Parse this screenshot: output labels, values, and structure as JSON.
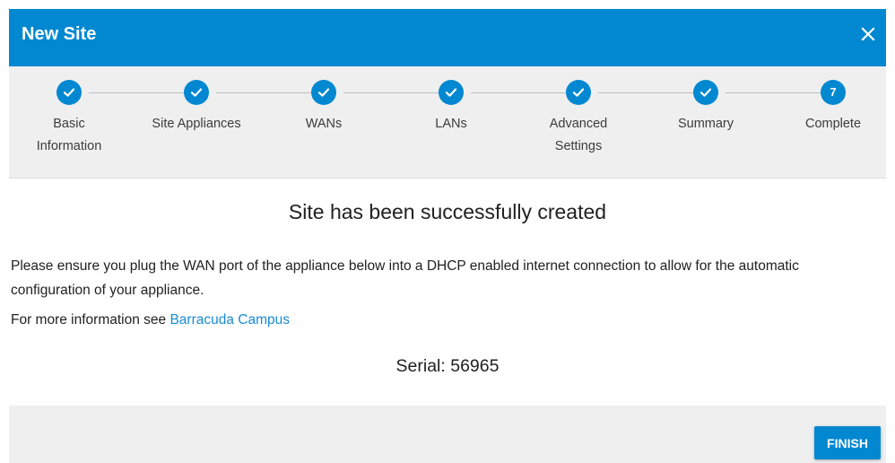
{
  "dialog": {
    "title": "New Site",
    "close_icon": "close-icon"
  },
  "stepper": {
    "steps": [
      {
        "label": "Basic\nInformation",
        "state": "complete",
        "icon": "check-icon"
      },
      {
        "label": "Site Appliances",
        "state": "complete",
        "icon": "check-icon"
      },
      {
        "label": "WANs",
        "state": "complete",
        "icon": "check-icon"
      },
      {
        "label": "LANs",
        "state": "complete",
        "icon": "check-icon"
      },
      {
        "label": "Advanced\nSettings",
        "state": "complete",
        "icon": "check-icon"
      },
      {
        "label": "Summary",
        "state": "complete",
        "icon": "check-icon"
      },
      {
        "label": "Complete",
        "state": "current",
        "number": "7"
      }
    ]
  },
  "content": {
    "heading": "Site has been successfully created",
    "instructions": "Please ensure you plug the WAN port of the appliance below into a DHCP enabled internet connection to allow for the automatic configuration of your appliance.",
    "more_info_prefix": "For more information see ",
    "more_info_link": "Barracuda Campus",
    "serial_label": "Serial: 56965"
  },
  "footer": {
    "finish_label": "FINISH"
  },
  "colors": {
    "accent": "#0288d1",
    "link": "#1a8bd2",
    "panel_background": "#efefef"
  }
}
